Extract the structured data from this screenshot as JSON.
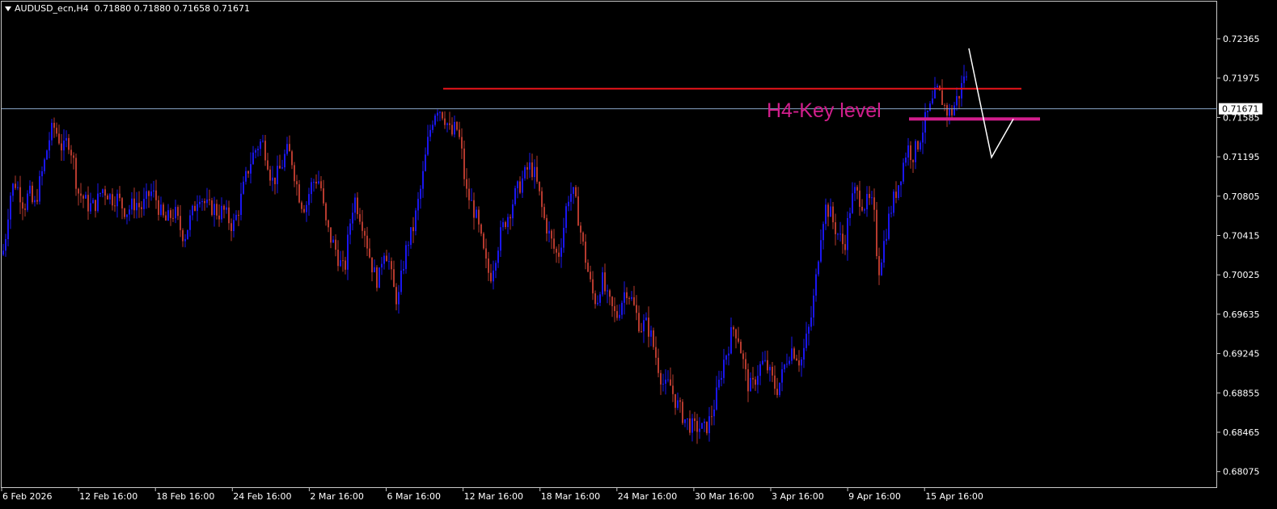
{
  "header": {
    "symbol": "AUDUSD_ecn,H4",
    "ohlc": "0.71880 0.71880 0.71658 0.71671"
  },
  "annotation": {
    "key_level_label": "H4-Key level"
  },
  "colors": {
    "bull": "#1a16f0",
    "bear": "#b63a2e",
    "resistance_line": "#e8141a",
    "key_level_line": "#d21e8c",
    "forecast_path": "#ffffff",
    "current_price_line": "#8aa6c8",
    "axis": "#c8c8c8",
    "background": "#000000"
  },
  "chart_data": {
    "type": "candlestick",
    "ylim": [
      0.6788,
      0.7256
    ],
    "y_ticks": [
      "0.72365",
      "0.71975",
      "0.71585",
      "0.71195",
      "0.70805",
      "0.70415",
      "0.70025",
      "0.69635",
      "0.69245",
      "0.68855",
      "0.68465",
      "0.68075"
    ],
    "x_ticks": [
      "6 Feb 2026",
      "12 Feb 16:00",
      "18 Feb 16:00",
      "24 Feb 16:00",
      "2 Mar 16:00",
      "6 Mar 16:00",
      "12 Mar 16:00",
      "18 Mar 16:00",
      "24 Mar 16:00",
      "30 Mar 16:00",
      "3 Apr 16:00",
      "9 Apr 16:00",
      "15 Apr 16:00"
    ],
    "current_price": 0.71671,
    "current_price_label": "0.71671",
    "resistance_level": 0.7187,
    "key_level": 0.7157,
    "close_path": [
      [
        0,
        0.701
      ],
      [
        6,
        0.7035
      ],
      [
        12,
        0.708
      ],
      [
        18,
        0.7095
      ],
      [
        24,
        0.7085
      ],
      [
        30,
        0.707
      ],
      [
        36,
        0.7085
      ],
      [
        42,
        0.7068
      ],
      [
        48,
        0.709
      ],
      [
        54,
        0.711
      ],
      [
        60,
        0.7135
      ],
      [
        66,
        0.715
      ],
      [
        72,
        0.714
      ],
      [
        78,
        0.7125
      ],
      [
        84,
        0.7138
      ],
      [
        90,
        0.712
      ],
      [
        96,
        0.7085
      ],
      [
        102,
        0.708
      ],
      [
        108,
        0.7072
      ],
      [
        114,
        0.707
      ],
      [
        120,
        0.7075
      ],
      [
        126,
        0.7088
      ],
      [
        132,
        0.7085
      ],
      [
        138,
        0.7078
      ],
      [
        144,
        0.708
      ],
      [
        150,
        0.7072
      ],
      [
        156,
        0.7065
      ],
      [
        162,
        0.707
      ],
      [
        168,
        0.7075
      ],
      [
        174,
        0.7068
      ],
      [
        180,
        0.7075
      ],
      [
        186,
        0.7085
      ],
      [
        192,
        0.708
      ],
      [
        198,
        0.7065
      ],
      [
        204,
        0.7055
      ],
      [
        210,
        0.706
      ],
      [
        216,
        0.7065
      ],
      [
        222,
        0.705
      ],
      [
        228,
        0.704
      ],
      [
        234,
        0.7055
      ],
      [
        240,
        0.7068
      ],
      [
        246,
        0.7085
      ],
      [
        252,
        0.7075
      ],
      [
        258,
        0.7068
      ],
      [
        264,
        0.707
      ],
      [
        270,
        0.7063
      ],
      [
        276,
        0.7067
      ],
      [
        282,
        0.7058
      ],
      [
        288,
        0.705
      ],
      [
        294,
        0.7065
      ],
      [
        300,
        0.7085
      ],
      [
        306,
        0.7105
      ],
      [
        312,
        0.712
      ],
      [
        318,
        0.713
      ],
      [
        324,
        0.7135
      ],
      [
        330,
        0.712
      ],
      [
        336,
        0.7095
      ],
      [
        342,
        0.71
      ],
      [
        348,
        0.711
      ],
      [
        354,
        0.7125
      ],
      [
        360,
        0.712
      ],
      [
        366,
        0.7095
      ],
      [
        372,
        0.7075
      ],
      [
        378,
        0.707
      ],
      [
        384,
        0.709
      ],
      [
        390,
        0.7098
      ],
      [
        396,
        0.7095
      ],
      [
        402,
        0.7055
      ],
      [
        408,
        0.704
      ],
      [
        414,
        0.703
      ],
      [
        420,
        0.7015
      ],
      [
        426,
        0.7005
      ],
      [
        432,
        0.705
      ],
      [
        438,
        0.708
      ],
      [
        444,
        0.7065
      ],
      [
        450,
        0.705
      ],
      [
        456,
        0.7025
      ],
      [
        462,
        0.7005
      ],
      [
        468,
        0.6995
      ],
      [
        474,
        0.703
      ],
      [
        480,
        0.702
      ],
      [
        486,
        0.699
      ],
      [
        492,
        0.6975
      ],
      [
        498,
        0.701
      ],
      [
        504,
        0.7035
      ],
      [
        510,
        0.7045
      ],
      [
        516,
        0.707
      ],
      [
        522,
        0.7095
      ],
      [
        528,
        0.713
      ],
      [
        534,
        0.7155
      ],
      [
        540,
        0.717
      ],
      [
        546,
        0.7165
      ],
      [
        552,
        0.7155
      ],
      [
        558,
        0.714
      ],
      [
        564,
        0.715
      ],
      [
        570,
        0.713
      ],
      [
        576,
        0.7085
      ],
      [
        582,
        0.7075
      ],
      [
        588,
        0.7062
      ],
      [
        594,
        0.704
      ],
      [
        600,
        0.7015
      ],
      [
        606,
        0.7
      ],
      [
        612,
        0.702
      ],
      [
        618,
        0.704
      ],
      [
        624,
        0.7055
      ],
      [
        630,
        0.7065
      ],
      [
        636,
        0.708
      ],
      [
        642,
        0.709
      ],
      [
        648,
        0.71
      ],
      [
        654,
        0.711
      ],
      [
        660,
        0.7105
      ],
      [
        666,
        0.7085
      ],
      [
        672,
        0.706
      ],
      [
        678,
        0.7045
      ],
      [
        684,
        0.703
      ],
      [
        690,
        0.702
      ],
      [
        696,
        0.7045
      ],
      [
        702,
        0.708
      ],
      [
        708,
        0.7085
      ],
      [
        714,
        0.7065
      ],
      [
        720,
        0.7035
      ],
      [
        726,
        0.701
      ],
      [
        732,
        0.6985
      ],
      [
        738,
        0.6975
      ],
      [
        744,
        0.7
      ],
      [
        750,
        0.698
      ],
      [
        756,
        0.697
      ],
      [
        762,
        0.696
      ],
      [
        768,
        0.6975
      ],
      [
        774,
        0.699
      ],
      [
        780,
        0.698
      ],
      [
        786,
        0.6965
      ],
      [
        792,
        0.695
      ],
      [
        798,
        0.6955
      ],
      [
        804,
        0.6945
      ],
      [
        810,
        0.6925
      ],
      [
        816,
        0.6905
      ],
      [
        822,
        0.689
      ],
      [
        828,
        0.6895
      ],
      [
        834,
        0.688
      ],
      [
        840,
        0.687
      ],
      [
        846,
        0.686
      ],
      [
        852,
        0.6855
      ],
      [
        858,
        0.685
      ],
      [
        864,
        0.6852
      ],
      [
        870,
        0.6848
      ],
      [
        876,
        0.6855
      ],
      [
        882,
        0.687
      ],
      [
        888,
        0.689
      ],
      [
        894,
        0.6915
      ],
      [
        900,
        0.693
      ],
      [
        906,
        0.695
      ],
      [
        912,
        0.6945
      ],
      [
        918,
        0.692
      ],
      [
        924,
        0.6895
      ],
      [
        930,
        0.689
      ],
      [
        936,
        0.6905
      ],
      [
        942,
        0.6915
      ],
      [
        948,
        0.6912
      ],
      [
        954,
        0.69
      ],
      [
        960,
        0.6888
      ],
      [
        966,
        0.69
      ],
      [
        972,
        0.6918
      ],
      [
        978,
        0.693
      ],
      [
        984,
        0.6925
      ],
      [
        990,
        0.6915
      ],
      [
        996,
        0.6935
      ],
      [
        1002,
        0.6955
      ],
      [
        1008,
        0.699
      ],
      [
        1014,
        0.704
      ],
      [
        1020,
        0.707
      ],
      [
        1026,
        0.7065
      ],
      [
        1032,
        0.705
      ],
      [
        1038,
        0.704
      ],
      [
        1044,
        0.703
      ],
      [
        1050,
        0.7065
      ],
      [
        1056,
        0.7085
      ],
      [
        1062,
        0.708
      ],
      [
        1068,
        0.7072
      ],
      [
        1074,
        0.7075
      ],
      [
        1080,
        0.707
      ],
      [
        1086,
        0.7005
      ],
      [
        1092,
        0.703
      ],
      [
        1098,
        0.7055
      ],
      [
        1104,
        0.7075
      ],
      [
        1110,
        0.709
      ],
      [
        1116,
        0.711
      ],
      [
        1122,
        0.713
      ],
      [
        1128,
        0.712
      ],
      [
        1134,
        0.713
      ],
      [
        1140,
        0.7145
      ],
      [
        1146,
        0.716
      ],
      [
        1152,
        0.717
      ],
      [
        1158,
        0.7185
      ],
      [
        1164,
        0.7178
      ],
      [
        1170,
        0.7165
      ],
      [
        1176,
        0.7162
      ],
      [
        1182,
        0.7175
      ],
      [
        1188,
        0.7185
      ],
      [
        1194,
        0.721
      ],
      [
        1197,
        0.7167
      ]
    ],
    "forecast_path": [
      [
        1197,
        0.7227
      ],
      [
        1225,
        0.7119
      ],
      [
        1252,
        0.7157
      ]
    ]
  }
}
